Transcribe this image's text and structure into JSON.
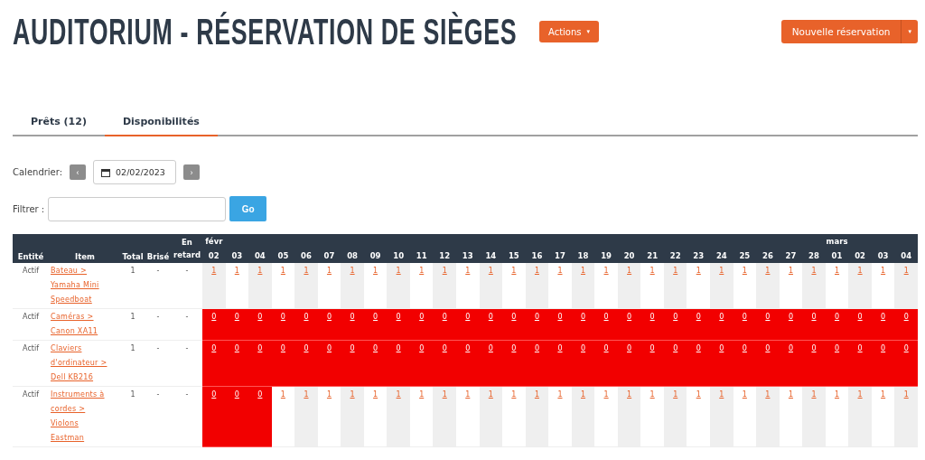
{
  "title": "AUDITORIUM - RÉSERVATION DE SIÈGES",
  "actions_button": {
    "label": "Actions",
    "caret": "▾"
  },
  "new_button": {
    "label": "Nouvelle réservation",
    "caret": "▾"
  },
  "tabs": [
    {
      "label": "Prêts (12)",
      "selected": false
    },
    {
      "label": "Disponibilités",
      "selected": true
    }
  ],
  "calendar": {
    "label": "Calendrier:",
    "prev": "‹",
    "date": "02/02/2023",
    "next": "›"
  },
  "filter": {
    "label": "Filtrer :",
    "button": "Go"
  },
  "table": {
    "columns": [
      {
        "label": "Entité"
      },
      {
        "label": "Item"
      },
      {
        "label": "Total"
      },
      {
        "label": "Brisé"
      },
      {
        "label": "En retard"
      }
    ],
    "days": [
      {
        "label": "02",
        "month": "févr"
      },
      {
        "label": "03"
      },
      {
        "label": "04"
      },
      {
        "label": "05"
      },
      {
        "label": "06"
      },
      {
        "label": "07"
      },
      {
        "label": "08"
      },
      {
        "label": "09"
      },
      {
        "label": "10"
      },
      {
        "label": "11"
      },
      {
        "label": "12"
      },
      {
        "label": "13"
      },
      {
        "label": "14"
      },
      {
        "label": "15"
      },
      {
        "label": "16"
      },
      {
        "label": "17"
      },
      {
        "label": "18"
      },
      {
        "label": "19"
      },
      {
        "label": "20"
      },
      {
        "label": "21"
      },
      {
        "label": "22"
      },
      {
        "label": "23"
      },
      {
        "label": "24"
      },
      {
        "label": "25"
      },
      {
        "label": "26"
      },
      {
        "label": "27"
      },
      {
        "label": "28"
      },
      {
        "label": "01",
        "month": "mars"
      },
      {
        "label": "02"
      },
      {
        "label": "03"
      },
      {
        "label": "04"
      }
    ],
    "rows": [
      {
        "entity": "Actif",
        "item": "Bateau > Yamaha Mini Speedboat",
        "total": "1",
        "broken": "-",
        "late": "-",
        "cells": [
          "1",
          "1",
          "1",
          "1",
          "1",
          "1",
          "1",
          "1",
          "1",
          "1",
          "1",
          "1",
          "1",
          "1",
          "1",
          "1",
          "1",
          "1",
          "1",
          "1",
          "1",
          "1",
          "1",
          "1",
          "1",
          "1",
          "1",
          "1",
          "1",
          "1",
          "1"
        ],
        "unavailable": [
          false,
          false,
          false,
          false,
          false,
          false,
          false,
          false,
          false,
          false,
          false,
          false,
          false,
          false,
          false,
          false,
          false,
          false,
          false,
          false,
          false,
          false,
          false,
          false,
          false,
          false,
          false,
          false,
          false,
          false,
          false
        ]
      },
      {
        "entity": "Actif",
        "item": "Caméras > Canon XA11",
        "total": "1",
        "broken": "-",
        "late": "-",
        "cells": [
          "0",
          "0",
          "0",
          "0",
          "0",
          "0",
          "0",
          "0",
          "0",
          "0",
          "0",
          "0",
          "0",
          "0",
          "0",
          "0",
          "0",
          "0",
          "0",
          "0",
          "0",
          "0",
          "0",
          "0",
          "0",
          "0",
          "0",
          "0",
          "0",
          "0",
          "0"
        ],
        "unavailable": [
          true,
          true,
          true,
          true,
          true,
          true,
          true,
          true,
          true,
          true,
          true,
          true,
          true,
          true,
          true,
          true,
          true,
          true,
          true,
          true,
          true,
          true,
          true,
          true,
          true,
          true,
          true,
          true,
          true,
          true,
          true
        ]
      },
      {
        "entity": "Actif",
        "item": "Claviers d'ordinateur > Dell KB216",
        "total": "1",
        "broken": "-",
        "late": "-",
        "cells": [
          "0",
          "0",
          "0",
          "0",
          "0",
          "0",
          "0",
          "0",
          "0",
          "0",
          "0",
          "0",
          "0",
          "0",
          "0",
          "0",
          "0",
          "0",
          "0",
          "0",
          "0",
          "0",
          "0",
          "0",
          "0",
          "0",
          "0",
          "0",
          "0",
          "0",
          "0"
        ],
        "unavailable": [
          true,
          true,
          true,
          true,
          true,
          true,
          true,
          true,
          true,
          true,
          true,
          true,
          true,
          true,
          true,
          true,
          true,
          true,
          true,
          true,
          true,
          true,
          true,
          true,
          true,
          true,
          true,
          true,
          true,
          true,
          true
        ]
      },
      {
        "entity": "Actif",
        "item": "Instruments à cordes > Violons Eastman",
        "total": "1",
        "broken": "-",
        "late": "-",
        "cells": [
          "0",
          "0",
          "0",
          "1",
          "1",
          "1",
          "1",
          "1",
          "1",
          "1",
          "1",
          "1",
          "1",
          "1",
          "1",
          "1",
          "1",
          "1",
          "1",
          "1",
          "1",
          "1",
          "1",
          "1",
          "1",
          "1",
          "1",
          "1",
          "1",
          "1",
          "1"
        ],
        "unavailable": [
          true,
          true,
          true,
          false,
          false,
          false,
          false,
          false,
          false,
          false,
          false,
          false,
          false,
          false,
          false,
          false,
          false,
          false,
          false,
          false,
          false,
          false,
          false,
          false,
          false,
          false,
          false,
          false,
          false,
          false,
          false
        ]
      }
    ]
  }
}
